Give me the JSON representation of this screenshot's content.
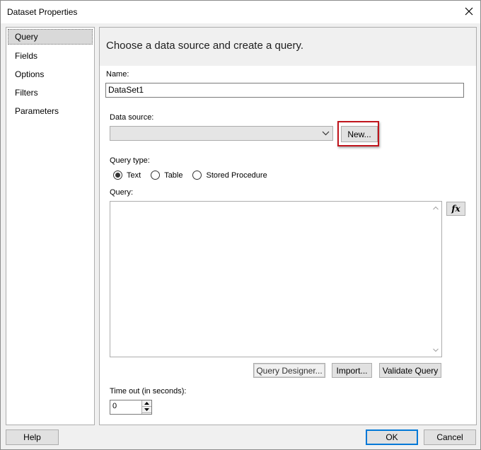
{
  "window": {
    "title": "Dataset Properties"
  },
  "nav": {
    "items": [
      {
        "label": "Query",
        "selected": true
      },
      {
        "label": "Fields",
        "selected": false
      },
      {
        "label": "Options",
        "selected": false
      },
      {
        "label": "Filters",
        "selected": false
      },
      {
        "label": "Parameters",
        "selected": false
      }
    ]
  },
  "panel": {
    "title": "Choose a data source and create a query.",
    "name_label": "Name:",
    "name_value": "DataSet1",
    "datasource_label": "Data source:",
    "datasource_value": "",
    "new_button": "New...",
    "query_type_label": "Query type:",
    "query_types": [
      {
        "label": "Text",
        "checked": true
      },
      {
        "label": "Table",
        "checked": false
      },
      {
        "label": "Stored Procedure",
        "checked": false
      }
    ],
    "query_label": "Query:",
    "query_value": "",
    "fx_button": "fx",
    "query_designer_button": "Query Designer...",
    "import_button": "Import...",
    "validate_button": "Validate Query",
    "timeout_label": "Time out (in seconds):",
    "timeout_value": "0"
  },
  "footer": {
    "help_button": "Help",
    "ok_button": "OK",
    "cancel_button": "Cancel"
  },
  "colors": {
    "highlight_border": "#c0141c",
    "default_button_border": "#0078d7"
  },
  "icons": {
    "close": "close-icon",
    "dropdown": "chevron-down-icon",
    "expression": "fx-icon"
  }
}
